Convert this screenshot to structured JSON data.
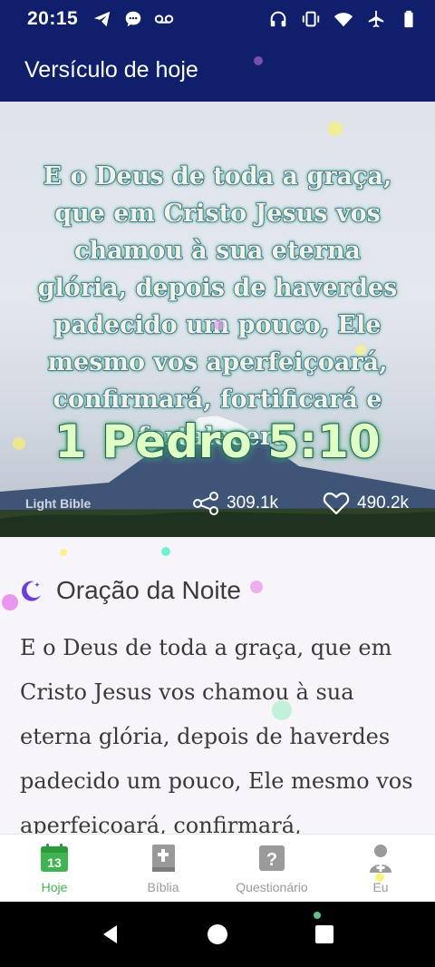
{
  "status_bar": {
    "time": "20:15",
    "left_icons": [
      "telegram-icon",
      "chat-icon",
      "voicemail-icon"
    ],
    "right_icons": [
      "headphones-icon",
      "vibrate-icon",
      "wifi-icon",
      "airplane-icon",
      "battery-icon"
    ]
  },
  "app_bar": {
    "title": "Versículo de hoje"
  },
  "verse": {
    "text": "E o Deus de toda a graça, que em Cristo Jesus vos chamou à sua eterna glória, depois de haverdes padecido um pouco, Ele mesmo vos aperfeiçoará, confirmará, fortificará e fortalecerá.",
    "reference": "1 Pedro 5:10",
    "brand": "Light Bible",
    "shares": "309.1k",
    "likes": "490.2k"
  },
  "prayer": {
    "title": "Oração da Noite",
    "icon": "moon-icon",
    "text": "E o Deus de toda a graça, que em Cristo Jesus vos chamou à sua eterna glória, depois de haverdes padecido um pouco, Ele mesmo vos aperfeiçoará, confirmará,"
  },
  "tabs": [
    {
      "label": "Hoje",
      "icon": "calendar-icon",
      "active": true
    },
    {
      "label": "Bíblia",
      "icon": "bible-icon",
      "active": false
    },
    {
      "label": "Questionário",
      "icon": "quiz-icon",
      "active": false
    },
    {
      "label": "Eu",
      "icon": "profile-icon",
      "active": false
    }
  ],
  "colors": {
    "header_bg": "#0f1f6b",
    "active_tab": "#3fb450",
    "inactive_tab": "#9a9a9a",
    "moon": "#6b3fd4"
  }
}
